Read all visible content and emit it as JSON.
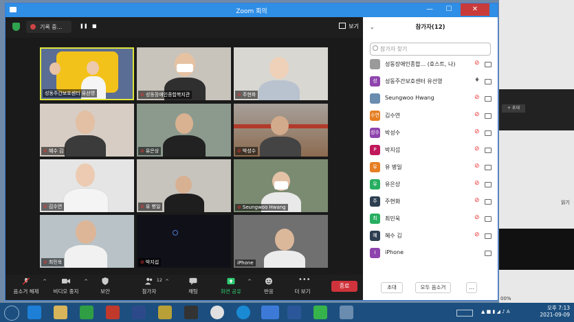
{
  "window": {
    "title": "Zoom 회의",
    "minimize": "—",
    "maximize": "☐",
    "close": "✕"
  },
  "recording": {
    "label": "기록 중...",
    "pause": "❚❚",
    "stop": "■"
  },
  "view_button": "보기",
  "tiles": [
    {
      "name": "성동주간보호센터 유선영",
      "muted": false
    },
    {
      "name": "성동장애인종합복지관",
      "muted": true
    },
    {
      "name": "주현화",
      "muted": true
    },
    {
      "name": "혜수 김",
      "muted": true
    },
    {
      "name": "유은상",
      "muted": true
    },
    {
      "name": "박성수",
      "muted": true
    },
    {
      "name": "김수연",
      "muted": true
    },
    {
      "name": "유 병일",
      "muted": true
    },
    {
      "name": "Seungwoo Hwang",
      "muted": true
    },
    {
      "name": "최민욱",
      "muted": true
    },
    {
      "name": "박지섭",
      "muted": true
    },
    {
      "name": "iPhone",
      "muted": false
    }
  ],
  "toolbar": {
    "mute": "음소거 해제",
    "video": "비디오 중지",
    "security": "보안",
    "participants": "참가자",
    "participants_count": "12",
    "chat": "채팅",
    "share": "화면 공유",
    "reactions": "반응",
    "more": "더 보기",
    "end": "종료"
  },
  "panel": {
    "title": "참가자(12)",
    "search_placeholder": "참가자 찾기",
    "participants": [
      {
        "name": "성동장애인종합... (호스트, 나)",
        "avatar": "",
        "color": "#888888"
      },
      {
        "name": "성동주간보호센터 유선영",
        "avatar": "성",
        "color": "#8e44ad"
      },
      {
        "name": "Seungwoo Hwang",
        "avatar": "",
        "color": "#6a8caf"
      },
      {
        "name": "김수연",
        "avatar": "수연",
        "color": "#e67e22"
      },
      {
        "name": "박성수",
        "avatar": "성수",
        "color": "#8e44ad"
      },
      {
        "name": "박지섭",
        "avatar": "P",
        "color": "#c0185b"
      },
      {
        "name": "유 병일",
        "avatar": "유",
        "color": "#e67e22"
      },
      {
        "name": "유은상",
        "avatar": "유",
        "color": "#27ae60"
      },
      {
        "name": "주현화",
        "avatar": "주",
        "color": "#2c3e50"
      },
      {
        "name": "최민욱",
        "avatar": "최",
        "color": "#27ae60"
      },
      {
        "name": "혜수 김",
        "avatar": "혜",
        "color": "#2c3e50"
      },
      {
        "name": "iPhone",
        "avatar": "I",
        "color": "#8e44ad"
      }
    ],
    "invite": "초대",
    "mute_all": "모두 음소거",
    "more": "..."
  },
  "side": {
    "invite_btn": "+ 초대",
    "menu": "읽기",
    "zoom_pct": "00%"
  },
  "clock": {
    "time": "오후 7:13",
    "date": "2021-09-09"
  }
}
